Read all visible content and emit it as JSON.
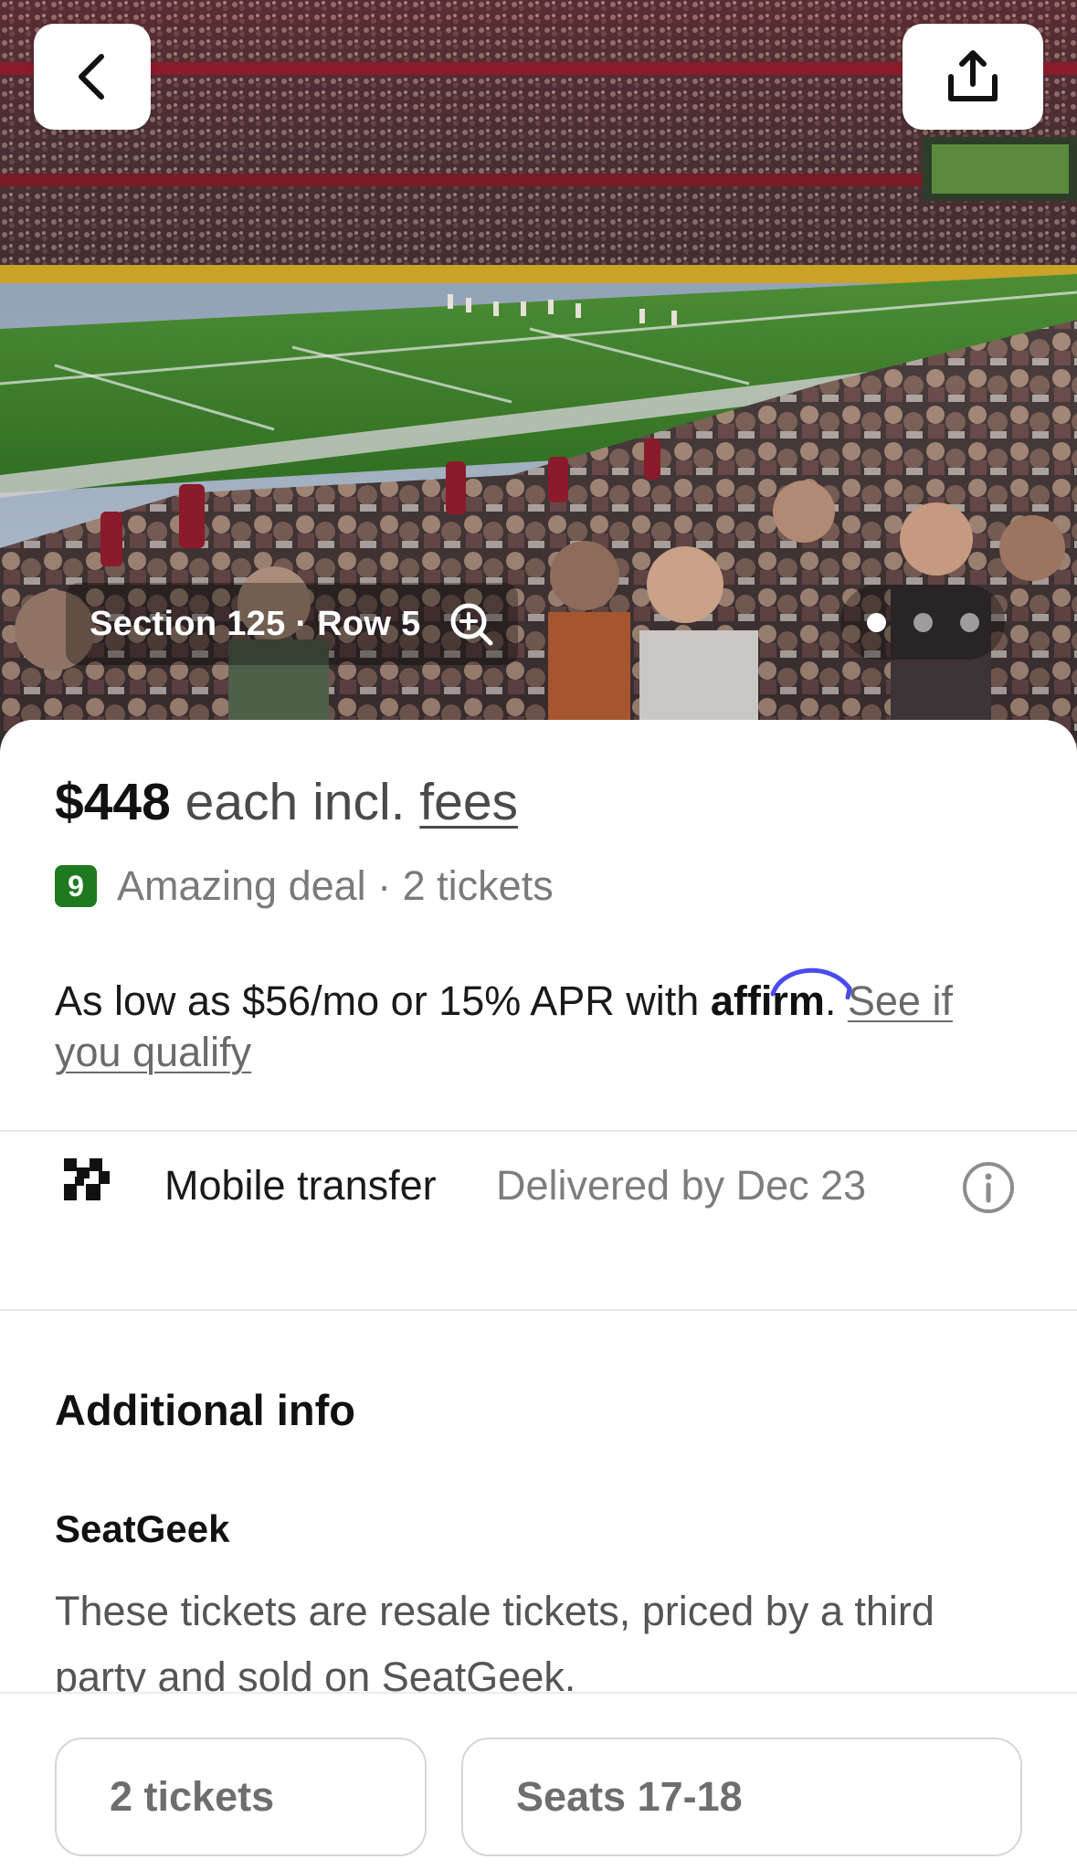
{
  "hero": {
    "section_label": "Section 125 · Row 5",
    "gallery_count": 3,
    "gallery_active_index": 0,
    "icons": {
      "back": "chevron-left-icon",
      "share": "share-icon",
      "zoom": "zoom-in-icon"
    }
  },
  "listing": {
    "price": "$448",
    "price_suffix": " each incl. ",
    "fees_link": "fees",
    "deal_score": "9",
    "deal_text": "Amazing deal · 2 tickets",
    "financing_text": "As low as $56/mo or 15% APR with ",
    "financing_brand": "affirm",
    "financing_link": "See if you qualify"
  },
  "delivery": {
    "method": "Mobile transfer",
    "when": "Delivered by Dec 23"
  },
  "additional_info": {
    "title": "Additional info",
    "seller": "SeatGeek",
    "description": "These tickets are resale tickets, priced by a third party and sold on SeatGeek."
  },
  "bottom_bar": {
    "quantity_label": "2 tickets",
    "seats_label": "Seats 17-18"
  },
  "colors": {
    "deal_badge": "#1f7a1f",
    "affirm_arc": "#4a4af4",
    "field": "#3f8a2a"
  }
}
